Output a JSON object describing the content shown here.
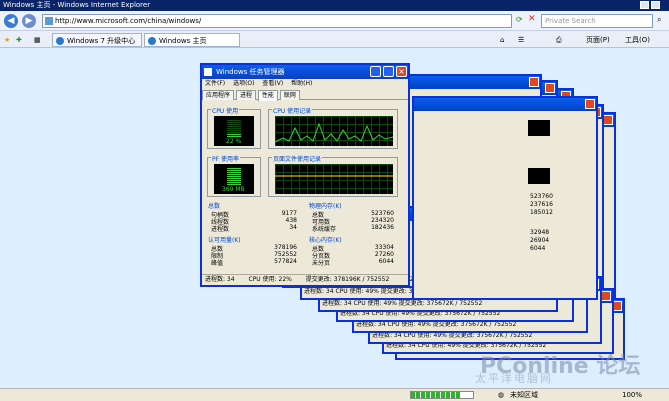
{
  "browser": {
    "title": "Windows 主页 - Windows Internet Explorer",
    "address": "http://www.microsoft.com/china/windows/",
    "search_placeholder": "Private Search",
    "tabs": [
      "Windows 7 升级中心",
      "Windows 主页"
    ],
    "tools": {
      "page": "页面(P)",
      "tools": "工具(O)"
    },
    "status": {
      "zone": "未知区域",
      "zoom": "100%"
    },
    "progress": 0.8
  },
  "task_manager": {
    "title": "Windows 任务管理器",
    "menu": [
      "文件(F)",
      "选项(O)",
      "查看(V)",
      "帮助(H)"
    ],
    "tabs": [
      "应用程序",
      "进程",
      "性能",
      "联网"
    ],
    "active_tab": "性能",
    "cpu_usage_label": "CPU 使用",
    "cpu_usage_value": "22 %",
    "cpu_history_label": "CPU 使用记录",
    "pf_label": "PF 使用率",
    "pf_value": "369 MB",
    "pf_history_label": "页面文件使用记录",
    "totals": {
      "title": "总数",
      "rows": [
        [
          "句柄数",
          "9177"
        ],
        [
          "线程数",
          "438"
        ],
        [
          "进程数",
          "34"
        ]
      ]
    },
    "physical": {
      "title": "物理内存(K)",
      "rows": [
        [
          "总数",
          "523760"
        ],
        [
          "可用数",
          "234320"
        ],
        [
          "系统缓存",
          "182436"
        ]
      ]
    },
    "commit": {
      "title": "认可用量(K)",
      "rows": [
        [
          "总数",
          "378196"
        ],
        [
          "限制",
          "752552"
        ],
        [
          "峰值",
          "577824"
        ]
      ]
    },
    "kernel": {
      "title": "核心内存(K)",
      "rows": [
        [
          "总数",
          "33304"
        ],
        [
          "分页数",
          "27260"
        ],
        [
          "未分页",
          "6044"
        ]
      ]
    },
    "statusbar": {
      "processes": "进程数: 34",
      "cpu": "CPU 使用: 22%",
      "commit": "提交更改: 378196K / 752552"
    },
    "cascade_status": "进程数: 34     CPU 使用: 49%     提交更改: 375672K / 752552",
    "cascade_values": [
      "523760",
      "237616",
      "185012",
      "32948",
      "26904",
      "6044"
    ]
  },
  "watermark": {
    "main": "PConline 论坛",
    "sub": "太平洋电脑网"
  }
}
